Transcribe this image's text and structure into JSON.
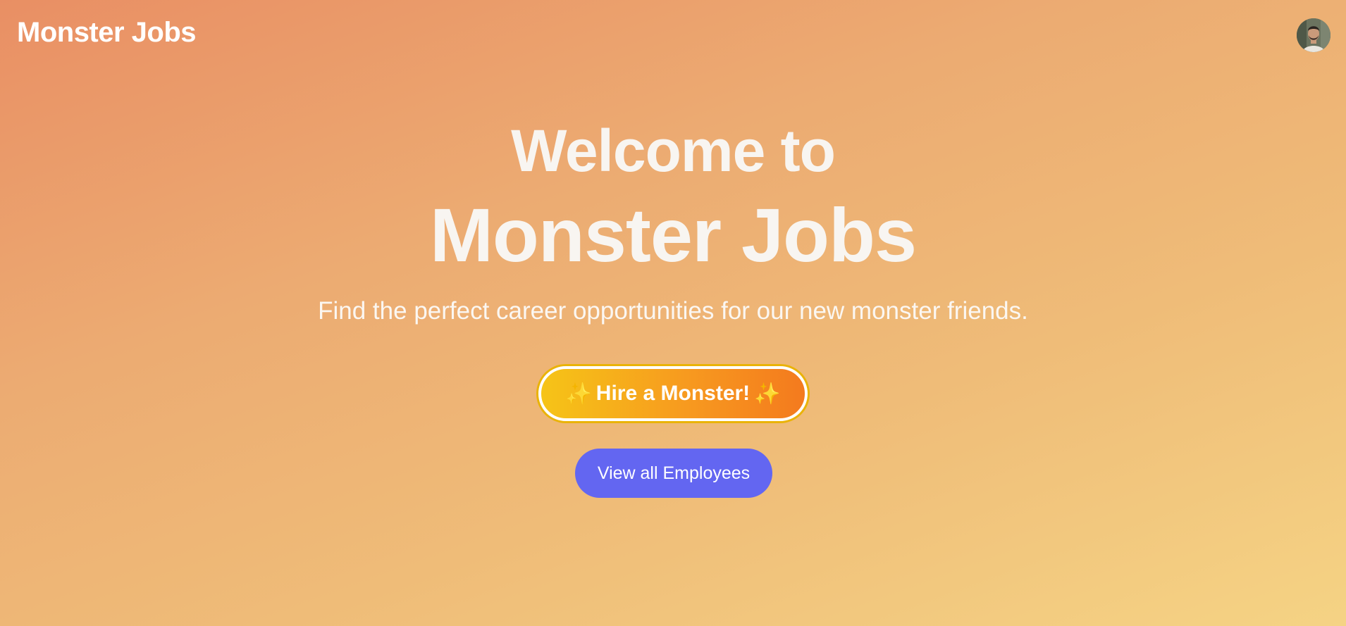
{
  "header": {
    "brand": "Monster Jobs",
    "avatar_icon": "user-avatar-photo"
  },
  "hero": {
    "welcome": "Welcome to",
    "title": "Monster Jobs",
    "subtitle": "Find the perfect career opportunities for our new monster friends."
  },
  "actions": {
    "hire_label": "Hire a Monster!",
    "sparkle": "✨",
    "sparkle_icon": "sparkles-icon",
    "view_label": "View all Employees"
  },
  "colors": {
    "background_start": "#e98f64",
    "background_end": "#f5d384",
    "hire_gradient_start": "#f6c417",
    "hire_gradient_end": "#f47a1e",
    "hire_outline": "#eab308",
    "view_button": "#6366f1",
    "text": "#ffffff"
  }
}
